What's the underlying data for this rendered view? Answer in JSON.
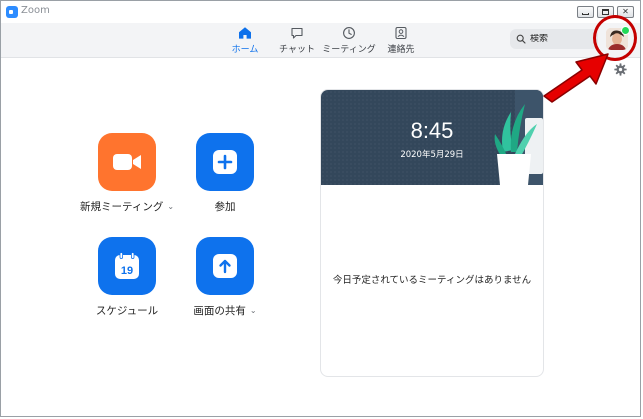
{
  "window": {
    "title": "Zoom",
    "controls": [
      "minimize",
      "maximize",
      "close"
    ]
  },
  "nav": {
    "tabs": [
      {
        "label": "ホーム",
        "icon": "home-icon",
        "active": true
      },
      {
        "label": "チャット",
        "icon": "chat-icon",
        "active": false
      },
      {
        "label": "ミーティング",
        "icon": "clock-icon",
        "active": false
      },
      {
        "label": "連絡先",
        "icon": "contacts-icon",
        "active": false
      }
    ],
    "search_placeholder": "検索"
  },
  "profile": {
    "status": "online",
    "status_color": "#23d959"
  },
  "actions": {
    "new_meeting": {
      "label": "新規ミーティング",
      "icon": "video-camera-icon",
      "color": "#ff742e",
      "has_dropdown": true
    },
    "join": {
      "label": "参加",
      "icon": "plus-icon",
      "color": "#0e72ed",
      "has_dropdown": false
    },
    "schedule": {
      "label": "スケジュール",
      "icon": "calendar-icon",
      "calendar_day": "19",
      "color": "#0e72ed",
      "has_dropdown": false
    },
    "share_screen": {
      "label": "画面の共有",
      "icon": "share-screen-icon",
      "color": "#0e72ed",
      "has_dropdown": true
    }
  },
  "card": {
    "time": "8:45",
    "date": "2020年5月29日",
    "empty_message": "今日予定されているミーティングはありません"
  },
  "colors": {
    "accent": "#0e71eb",
    "annotation": "#c40000"
  }
}
